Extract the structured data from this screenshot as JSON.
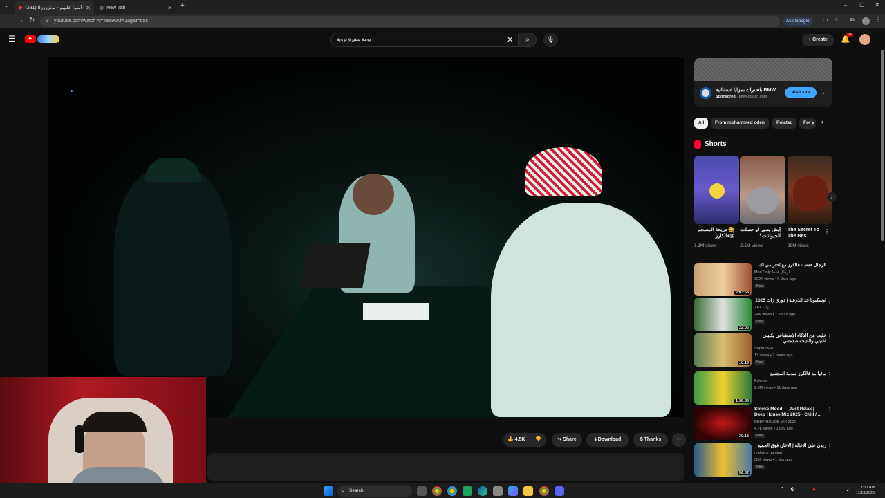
{
  "browser": {
    "tabs": [
      {
        "title": "(281) أسوأ عليهم - لوتززززاا - ...",
        "active": true
      },
      {
        "title": "New Tab",
        "active": false
      }
    ],
    "url": "youtube.com/watch?v=Te596KfX1ag&t=65s",
    "ask_google": "Ask Google"
  },
  "youtube": {
    "search_value": "يومة ستيرة تروية",
    "create_label": "Create",
    "notification_count": "9+"
  },
  "actions": {
    "likes": "4.5K",
    "share": "Share",
    "download": "Download",
    "thanks": "Thanks"
  },
  "ad": {
    "title": "باشتراك بمزايا استثنائية BMW",
    "sponsored": "Sponsored",
    "domain": "bmw-jordan.com",
    "visit": "Visit site"
  },
  "chips": [
    "All",
    "From mohammed oden",
    "Related",
    "For y"
  ],
  "shorts": {
    "heading": "Shorts",
    "items": [
      {
        "title": "😂 دريحة المسجم @قالكارز",
        "views": "1.1M views"
      },
      {
        "title": "أيش يصير لو حصلت الحيوانات؟",
        "views": "2.5M views"
      },
      {
        "title": "The Secret To The Bes...",
        "views": "29M views"
      }
    ]
  },
  "videos": [
    {
      "title": "الرجال فقط - فالكرز مع احترامي لك",
      "channel": "Men Only الرجال فقط",
      "meta": "302K views • 6 days ago",
      "badge": "New",
      "duration": "2:03:53"
    },
    {
      "title": "اوسكيوبا حد الدرعية | دوري زات 2025",
      "channel": "ZAT زات",
      "meta": "24K views • 7 hours ago",
      "badge": "New",
      "duration": "22:06"
    },
    {
      "title": "خليت من الذكاء الاصطناعي يكتبلي اغنيتي والنتيجة صدمتني",
      "channel": "SuperPSPC",
      "meta": "17 views • 7 hours ago",
      "badge": "New",
      "duration": "10:13"
    },
    {
      "title": "ماقيا مع فالكرز صدمة المجتمع",
      "channel": "Falcons",
      "meta": "2.9M views • 11 days ago",
      "badge": "",
      "duration": "1:38:35"
    },
    {
      "title": "Smoke Mood — Just Relax | Deep House Mix 2025 · Chill / ...",
      "channel": "DEEP HOUSE MIX 2025",
      "meta": "4.7K views • 1 day ago",
      "badge": "New",
      "duration": "30:18"
    },
    {
      "title": "زيدي على الاعاله | الاعان فوق الجميع",
      "channel": "mahwco gaming",
      "meta": "50K views • 1 day ago",
      "badge": "New",
      "duration": "56:32"
    }
  ],
  "taskbar": {
    "search": "Search",
    "time": "1:17 AM",
    "date": "11/13/2025"
  }
}
